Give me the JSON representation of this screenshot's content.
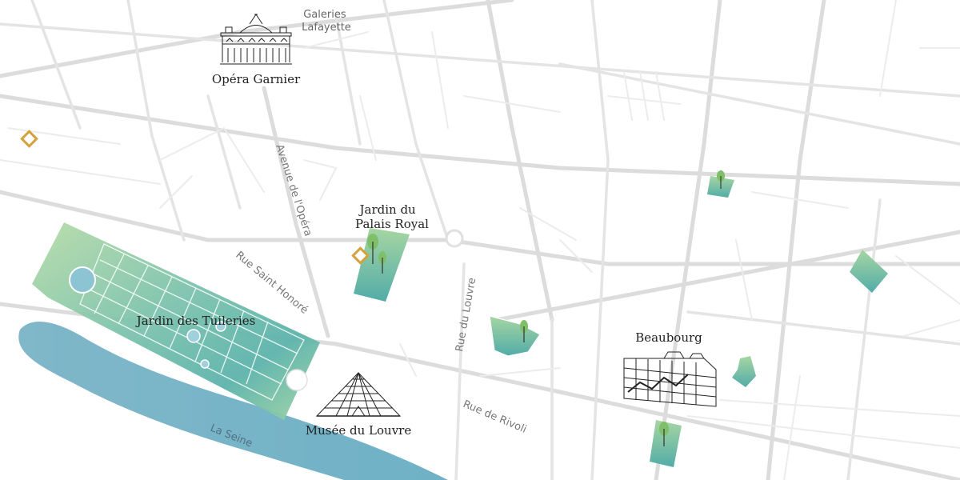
{
  "colors": {
    "background": "#ffffff",
    "road": "#e0e0e0",
    "water": "#7fb5c8",
    "park_light": "#a9d5a4",
    "park_dark": "#5ab3ae",
    "marker": "#d4a23a",
    "ink": "#222222"
  },
  "landmarks": {
    "opera": {
      "label": "Opéra Garnier",
      "icon": "opera-building-icon"
    },
    "galeries": {
      "line1": "Galeries",
      "line2": "Lafayette"
    },
    "palais_royal": {
      "line1": "Jardin du",
      "line2": "Palais Royal"
    },
    "tuileries": {
      "label": "Jardin des Tuileries"
    },
    "louvre": {
      "label": "Musée du Louvre",
      "icon": "louvre-pyramid-icon"
    },
    "beaubourg": {
      "label": "Beaubourg",
      "icon": "pompidou-centre-icon"
    }
  },
  "streets": {
    "avenue_opera": "Avenue de l'Opéra",
    "rue_saint_honore": "Rue Saint Honoré",
    "rue_du_louvre": "Rue du Louvre",
    "rue_de_rivoli": "Rue de Rivoli",
    "seine": "La Seine"
  },
  "markers": [
    {
      "name": "marker-west",
      "icon": "diamond-marker-icon"
    },
    {
      "name": "marker-palais-royal",
      "icon": "diamond-marker-icon"
    }
  ]
}
